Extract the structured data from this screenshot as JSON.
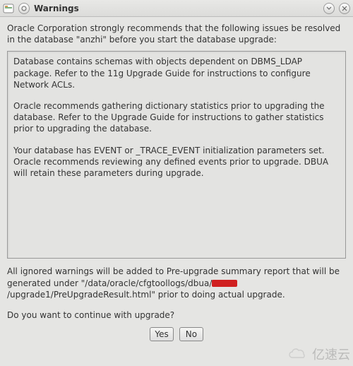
{
  "window": {
    "title": "Warnings"
  },
  "intro": "Oracle Corporation strongly recommends that the following issues be resolved in the database \"anzhi\" before you start the database upgrade:",
  "warnings": {
    "p1": "Database contains schemas with objects dependent on DBMS_LDAP package. Refer to the 11g Upgrade Guide for instructions to configure Network ACLs.",
    "p2": "Oracle recommends gathering dictionary statistics prior to upgrading the database. Refer to the Upgrade Guide for instructions to gather statistics prior to upgrading the database.",
    "p3": "Your database has EVENT or _TRACE_EVENT initialization parameters set. Oracle recommends reviewing any defined events prior to upgrade. DBUA will retain these parameters during upgrade."
  },
  "footer": {
    "prefix": "All ignored warnings will be added to Pre-upgrade summary report that will be generated under \"/data/oracle/cfgtoollogs/dbua/",
    "suffix": "/upgrade1/PreUpgradeResult.html\" prior to doing actual upgrade."
  },
  "question": "Do you want to continue with upgrade?",
  "buttons": {
    "yes": "Yes",
    "no": "No"
  },
  "watermark": "亿速云"
}
